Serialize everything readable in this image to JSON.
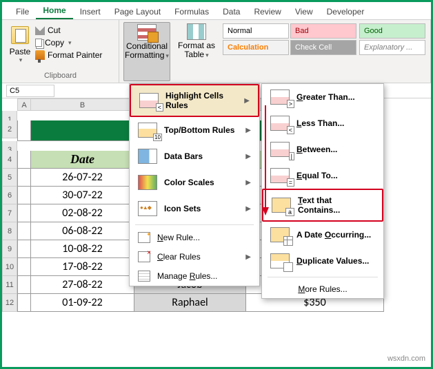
{
  "tabs": [
    "File",
    "Home",
    "Insert",
    "Page Layout",
    "Formulas",
    "Data",
    "Review",
    "View",
    "Developer"
  ],
  "active_tab": "Home",
  "clipboard": {
    "paste": "Paste",
    "cut": "Cut",
    "copy": "Copy",
    "format_painter": "Format Painter",
    "group_label": "Clipboard"
  },
  "styles": {
    "conditional_formatting": "Conditional Formatting",
    "format_as_table": "Format as Table",
    "cells": {
      "normal": "Normal",
      "bad": "Bad",
      "good": "Good",
      "calculation": "Calculation",
      "check_cell": "Check Cell",
      "explanatory": "Explanatory ..."
    }
  },
  "namebox": "C5",
  "columns": {
    "A": 20,
    "B": 150,
    "C": 162,
    "D": 100
  },
  "rows": [
    "1",
    "2",
    "3",
    "4",
    "5",
    "6",
    "7",
    "8",
    "9",
    "10",
    "11",
    "12"
  ],
  "title_cell": "C",
  "headers": {
    "B": "Date"
  },
  "data_rows": [
    {
      "row": "5",
      "B": "26-07-22",
      "C": "",
      "D": ""
    },
    {
      "row": "6",
      "B": "30-07-22",
      "C": "",
      "D": ""
    },
    {
      "row": "7",
      "B": "02-08-22",
      "C": "",
      "D": ""
    },
    {
      "row": "8",
      "B": "06-08-22",
      "C": "",
      "D": ""
    },
    {
      "row": "9",
      "B": "10-08-22",
      "C": "",
      "D": ""
    },
    {
      "row": "10",
      "B": "17-08-22",
      "C": "",
      "D": ""
    },
    {
      "row": "11",
      "B": "27-08-22",
      "C": "Jacob",
      "D": ""
    },
    {
      "row": "12",
      "B": "01-09-22",
      "C": "Raphael",
      "D": "$350"
    }
  ],
  "cf_menu": {
    "highlight": "Highlight Cells Rules",
    "topbottom": "Top/Bottom Rules",
    "databars": "Data Bars",
    "colorscales": "Color Scales",
    "iconsets": "Icon Sets",
    "new_rule": "New Rule...",
    "clear_rules": "Clear Rules",
    "manage_rules": "Manage Rules..."
  },
  "hl_submenu": {
    "greater": "Greater Than...",
    "less": "Less Than...",
    "between": "Between...",
    "equal": "Equal To...",
    "text_contains": "Text that Contains...",
    "date": "A Date Occurring...",
    "duplicate": "Duplicate Values...",
    "more": "More Rules..."
  },
  "watermark": "wsxdn.com"
}
